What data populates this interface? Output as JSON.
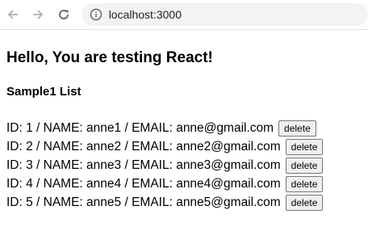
{
  "browser": {
    "url": "localhost:3000",
    "icons": {
      "back": "arrow-left-icon",
      "forward": "arrow-right-icon",
      "reload": "reload-icon",
      "info": "info-icon"
    }
  },
  "page": {
    "heading": "Hello, You are testing React!",
    "subheading": "Sample1 List",
    "users": [
      {
        "text": "ID: 1 / NAME: anne1 / EMAIL: anne@gmail.com",
        "button": "delete"
      },
      {
        "text": "ID: 2 / NAME: anne2 / EMAIL: anne2@gmail.com",
        "button": "delete"
      },
      {
        "text": "ID: 3 / NAME: anne3 / EMAIL: anne3@gmail.com",
        "button": "delete"
      },
      {
        "text": "ID: 4 / NAME: anne4 / EMAIL: anne4@gmail.com",
        "button": "delete"
      },
      {
        "text": "ID: 5 / NAME: anne5 / EMAIL: anne5@gmail.com",
        "button": "delete"
      }
    ]
  }
}
